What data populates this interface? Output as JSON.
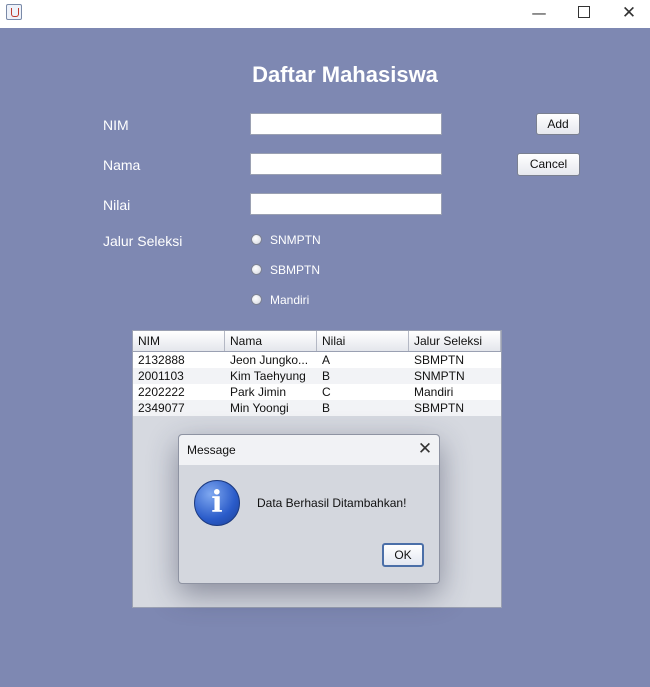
{
  "window": {
    "app_icon": "java-cup-icon",
    "controls": {
      "minimize": "—",
      "close": "✕"
    }
  },
  "form": {
    "heading": "Daftar Mahasiswa",
    "labels": {
      "nim": "NIM",
      "nama": "Nama",
      "nilai": "Nilai",
      "jalur": "Jalur Seleksi"
    },
    "inputs": {
      "nim": "",
      "nama": "",
      "nilai": ""
    },
    "radios": [
      {
        "label": "SNMPTN",
        "selected": false
      },
      {
        "label": "SBMPTN",
        "selected": false
      },
      {
        "label": "Mandiri",
        "selected": false
      }
    ],
    "buttons": {
      "add": "Add",
      "cancel": "Cancel"
    }
  },
  "table": {
    "columns": [
      "NIM",
      "Nama",
      "Nilai",
      "Jalur Seleksi"
    ],
    "rows": [
      [
        "2132888",
        "Jeon Jungko...",
        "A",
        "SBMPTN"
      ],
      [
        "2001103",
        "Kim Taehyung",
        "B",
        "SNMPTN"
      ],
      [
        "2202222",
        "Park Jimin",
        "C",
        "Mandiri"
      ],
      [
        "2349077",
        "Min Yoongi",
        "B",
        "SBMPTN"
      ]
    ]
  },
  "dialog": {
    "title": "Message",
    "close": "✕",
    "icon": "information-icon",
    "icon_glyph": "i",
    "message": "Data Berhasil Ditambahkan!",
    "ok_label": "OK"
  }
}
